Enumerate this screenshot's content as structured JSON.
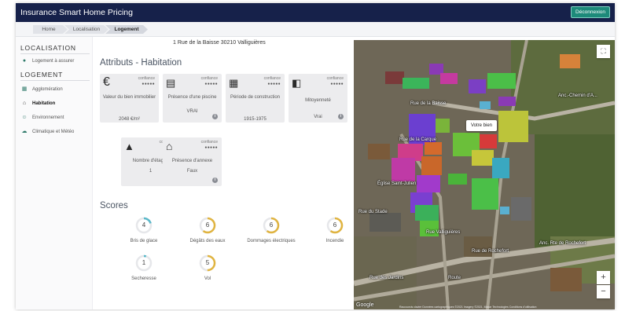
{
  "app": {
    "title": "Insurance Smart Home Pricing",
    "logout_label": "Déconnexion"
  },
  "breadcrumb": [
    "Home",
    "Localisation",
    "Logement"
  ],
  "sidebar": {
    "sections": [
      {
        "title": "LOCALISATION",
        "items": [
          {
            "label": "Logement à assurer",
            "icon": "globe-icon"
          }
        ]
      },
      {
        "title": "LOGEMENT",
        "items": [
          {
            "label": "Agglomération",
            "icon": "building-icon"
          },
          {
            "label": "Habitation",
            "icon": "home-icon",
            "active": true
          },
          {
            "label": "Environnement",
            "icon": "people-icon"
          },
          {
            "label": "Climatique et Météo",
            "icon": "weather-icon"
          }
        ]
      }
    ]
  },
  "address": "1 Rue de la Baisse 30210 Valliguières",
  "attributes": {
    "title": "Attributs - Habitation",
    "confidence_label": "confiance",
    "cards": [
      {
        "icon": "euro-icon",
        "label": "Valeur du bien immobilier",
        "value": "2048 €/m²"
      },
      {
        "icon": "pool-icon",
        "label": "Présence d'une piscine",
        "value": "VRAI"
      },
      {
        "icon": "calendar-icon",
        "label": "Période de construction",
        "value": "1915-1975"
      },
      {
        "icon": "building-icon",
        "label": "Mitoyenneté",
        "value": "Vrai"
      },
      {
        "icon": "floors-icon",
        "label": "Nombre d'étages",
        "value": "1"
      },
      {
        "icon": "house-icon",
        "label": "Présence d'annexe",
        "value": "Faux"
      }
    ]
  },
  "scores": {
    "title": "Scores",
    "items": [
      {
        "label": "Bris de glace",
        "value": "4",
        "color": "#5bb8c9",
        "fraction": 0.2
      },
      {
        "label": "Dégâts des eaux",
        "value": "6",
        "color": "#e0b440",
        "fraction": 0.6
      },
      {
        "label": "Dommages électriques",
        "value": "6",
        "color": "#e0b440",
        "fraction": 0.6
      },
      {
        "label": "Incendie",
        "value": "6",
        "color": "#e0b440",
        "fraction": 0.6
      },
      {
        "label": "Secheresse",
        "value": "1",
        "color": "#5bb8c9",
        "fraction": 0.05
      },
      {
        "label": "Vol",
        "value": "5",
        "color": "#e0b440",
        "fraction": 0.5
      }
    ]
  },
  "map": {
    "tooltip": "Votre bien",
    "zoom_in": "+",
    "zoom_out": "−",
    "fullscreen": "⛶",
    "google": "Google",
    "attribution": "Raccourcis clavier  Données cartographiques ©2021 Imagery ©2021, Maxar Technologies  Conditions d'utilisation",
    "labels": [
      "Rue de la Baisse",
      "Anc.-Chemin d'A...",
      "Rue de la Carque",
      "Église Saint-Julien",
      "Rue du Stade",
      "Rue Valliguières",
      "Rue de Rochefort",
      "Anc. Rte de Rochefort",
      "Rue des Jardins",
      "Route"
    ]
  }
}
